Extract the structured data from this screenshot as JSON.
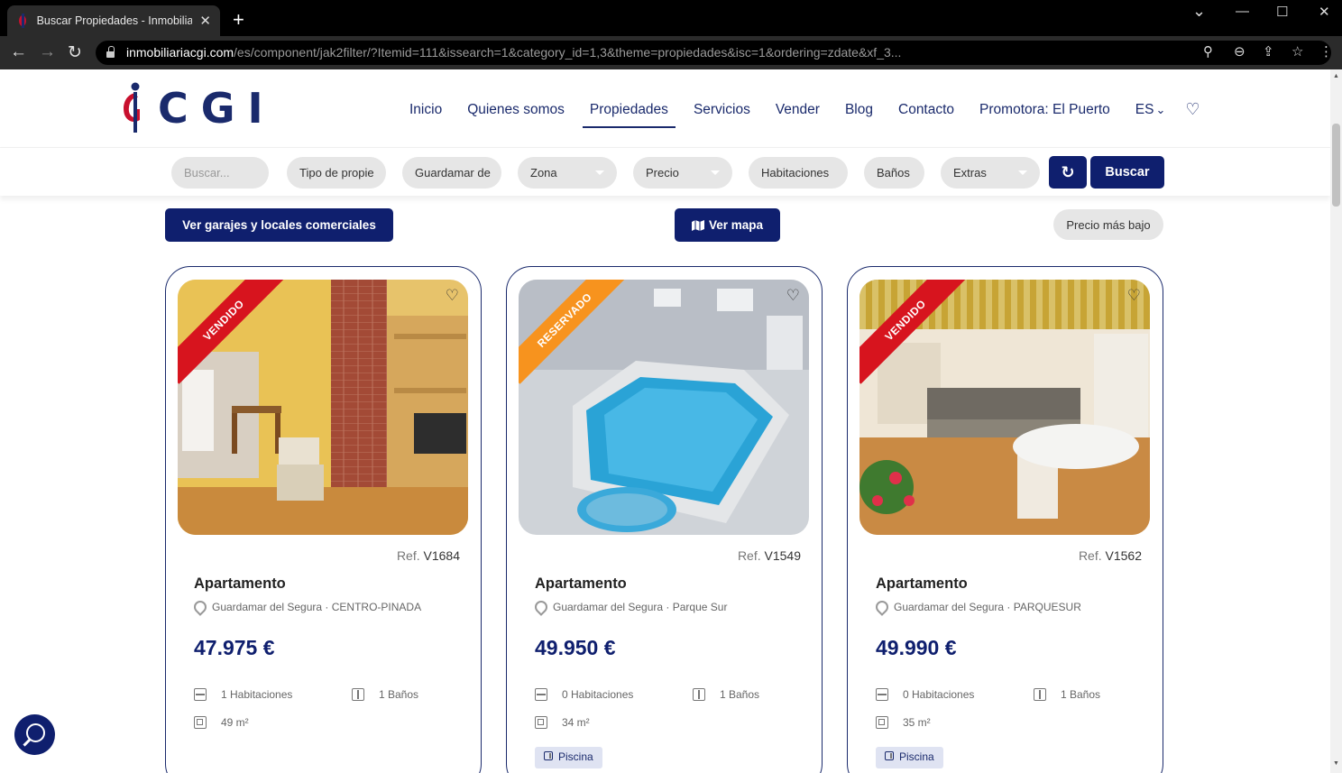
{
  "browser": {
    "tab_title": "Buscar Propiedades - Inmobiliaria CGI",
    "tab_close": "✕",
    "new_tab": "+",
    "url_host": "inmobiliariacgi.com",
    "url_path": "/es/component/jak2filter/?Itemid=111&issearch=1&category_id=1,3&theme=propiedades&isc=1&ordering=zdate&xf_3...",
    "controls": {
      "minimize": "—",
      "restore": "☐",
      "close": "✕",
      "dropdown": "⌄"
    },
    "nav": {
      "back": "←",
      "forward": "→",
      "reload": "↻"
    },
    "omni_icons": {
      "search": "⚲",
      "zoom": "⊖",
      "share": "⇪",
      "star": "☆",
      "menu": "⋮"
    }
  },
  "site": {
    "logo_text": "CGI",
    "brand_colors": {
      "navy": "#0f1f6e",
      "red": "#c8102e",
      "orange": "#f7931e"
    },
    "nav": [
      {
        "label": "Inicio"
      },
      {
        "label": "Quienes somos"
      },
      {
        "label": "Propiedades",
        "active": true
      },
      {
        "label": "Servicios"
      },
      {
        "label": "Vender"
      },
      {
        "label": "Blog"
      },
      {
        "label": "Contacto"
      },
      {
        "label": "Promotora: El Puerto"
      }
    ],
    "lang": "ES",
    "lang_caret": "⌄",
    "wishlist_icon": "♡"
  },
  "filters": {
    "search_placeholder": "Buscar...",
    "type": "Tipo de propie",
    "location": "Guardamar de",
    "zone": "Zona",
    "price": "Precio",
    "rooms": "Habitaciones",
    "baths": "Baños",
    "extras": "Extras",
    "reset_icon": "↻",
    "search_button": "Buscar"
  },
  "actions": {
    "garages_button": "Ver garajes y locales comerciales",
    "map_button": "Ver mapa",
    "sort": "Precio más bajo"
  },
  "listings": [
    {
      "status": "VENDIDO",
      "status_color": "#d7141e",
      "ref_label": "Ref.",
      "ref": "V1684",
      "type": "Apartamento",
      "location": "Guardamar del Segura · CENTRO-PINADA",
      "price": "47.975 €",
      "rooms": "1 Habitaciones",
      "baths": "1 Baños",
      "area": "49 m²"
    },
    {
      "status": "RESERVADO",
      "status_color": "#f7931e",
      "ref_label": "Ref.",
      "ref": "V1549",
      "type": "Apartamento",
      "location": "Guardamar del Segura · Parque Sur",
      "price": "49.950 €",
      "rooms": "0 Habitaciones",
      "baths": "1 Baños",
      "area": "34 m²",
      "tag": "Piscina"
    },
    {
      "status": "VENDIDO",
      "status_color": "#d7141e",
      "ref_label": "Ref.",
      "ref": "V1562",
      "type": "Apartamento",
      "location": "Guardamar del Segura · PARQUESUR",
      "price": "49.990 €",
      "rooms": "0 Habitaciones",
      "baths": "1 Baños",
      "area": "35 m²",
      "tag": "Piscina"
    }
  ]
}
